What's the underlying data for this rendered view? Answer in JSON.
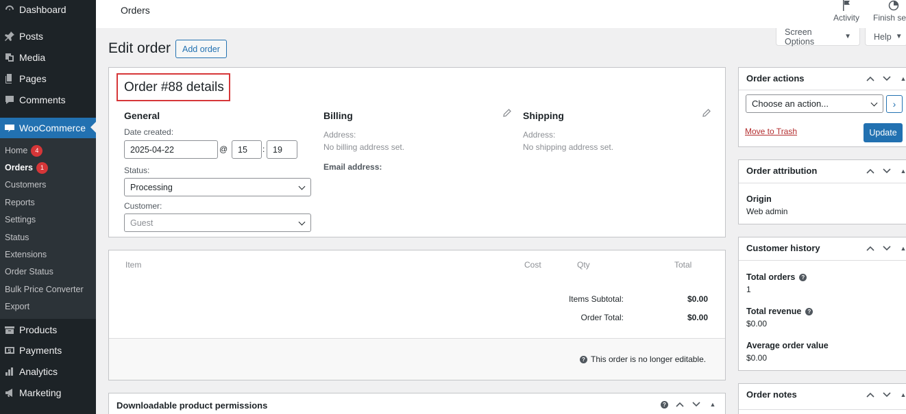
{
  "sidebar": {
    "items": [
      {
        "label": "Dashboard",
        "icon": "dashboard-icon"
      },
      {
        "label": "Posts",
        "icon": "pin-icon"
      },
      {
        "label": "Media",
        "icon": "media-icon"
      },
      {
        "label": "Pages",
        "icon": "pages-icon"
      },
      {
        "label": "Comments",
        "icon": "comment-icon"
      },
      {
        "label": "WooCommerce",
        "icon": "woo-icon"
      },
      {
        "label": "Products",
        "icon": "products-icon"
      },
      {
        "label": "Payments",
        "icon": "payments-icon"
      },
      {
        "label": "Analytics",
        "icon": "analytics-icon"
      },
      {
        "label": "Marketing",
        "icon": "marketing-icon"
      }
    ],
    "submenu": [
      {
        "label": "Home",
        "badge": "4"
      },
      {
        "label": "Orders",
        "badge": "1"
      },
      {
        "label": "Customers"
      },
      {
        "label": "Reports"
      },
      {
        "label": "Settings"
      },
      {
        "label": "Status"
      },
      {
        "label": "Extensions"
      },
      {
        "label": "Order Status"
      },
      {
        "label": "Bulk Price Converter"
      },
      {
        "label": "Export"
      }
    ]
  },
  "topbar": {
    "title": "Orders",
    "activity": "Activity",
    "finish_setup": "Finish set"
  },
  "screen_options": "Screen Options",
  "help": "Help",
  "page": {
    "title": "Edit order",
    "add_order": "Add order"
  },
  "order": {
    "title": "Order #88 details",
    "general": {
      "heading": "General",
      "date_label": "Date created:",
      "date": "2025-04-22",
      "at": "@",
      "hour": "15",
      "colon": ":",
      "minute": "19",
      "status_label": "Status:",
      "status": "Processing",
      "customer_label": "Customer:",
      "customer": "Guest"
    },
    "billing": {
      "heading": "Billing",
      "address_label": "Address:",
      "address": "No billing address set.",
      "email_label": "Email address:"
    },
    "shipping": {
      "heading": "Shipping",
      "address_label": "Address:",
      "address": "No shipping address set."
    }
  },
  "items": {
    "columns": {
      "item": "Item",
      "cost": "Cost",
      "qty": "Qty",
      "total": "Total"
    },
    "subtotal_label": "Items Subtotal:",
    "subtotal": "$0.00",
    "total_label": "Order Total:",
    "total": "$0.00",
    "notice": "This order is no longer editable."
  },
  "downloads": {
    "title": "Downloadable product permissions"
  },
  "order_actions": {
    "title": "Order actions",
    "select": "Choose an action...",
    "go": "›",
    "trash": "Move to Trash",
    "update": "Update"
  },
  "attribution": {
    "title": "Order attribution",
    "origin_label": "Origin",
    "origin": "Web admin"
  },
  "customer_history": {
    "title": "Customer history",
    "total_orders_label": "Total orders",
    "total_orders": "1",
    "total_revenue_label": "Total revenue",
    "total_revenue": "$0.00",
    "aov_label": "Average order value",
    "aov": "$0.00"
  },
  "order_notes": {
    "title": "Order notes"
  },
  "colors": {
    "sidebar": "#1d2327",
    "submenu": "#2c3338",
    "accent": "#2271b1",
    "danger": "#d63638"
  }
}
